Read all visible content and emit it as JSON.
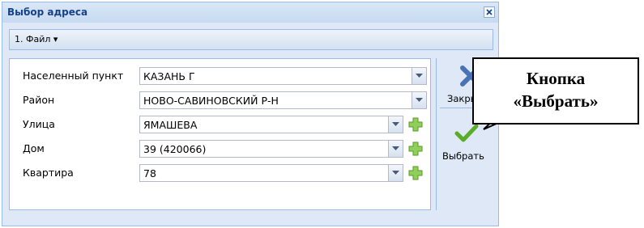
{
  "dialog": {
    "title": "Выбор адреса",
    "menu_label": "1. Файл ▾"
  },
  "form": {
    "fields": [
      {
        "label": "Населенный пункт",
        "value": "КАЗАНЬ Г",
        "has_add": false
      },
      {
        "label": "Район",
        "value": "НОВО-САВИНОВСКИЙ Р-Н",
        "has_add": false
      },
      {
        "label": "Улица",
        "value": "ЯМАШЕВА",
        "has_add": true
      },
      {
        "label": "Дом",
        "value": "39 (420066)",
        "has_add": true
      },
      {
        "label": "Квартира",
        "value": "78",
        "has_add": true
      }
    ]
  },
  "actions": {
    "close_label": "Закрыть",
    "select_label": "Выбрать"
  },
  "callout": {
    "line1": "Кнопка",
    "line2": "«Выбрать»"
  },
  "icons": {
    "close": "close-icon",
    "dropdown": "chevron-down-icon",
    "add": "plus-icon",
    "check": "check-icon",
    "close_x": "x-icon"
  },
  "colors": {
    "title_text": "#15428b",
    "window_bg": "#dfe8f6",
    "border": "#99bbe8",
    "plus_green": "#7ec34a",
    "check_green": "#5aad2a",
    "close_blue": "#4a73b5"
  }
}
